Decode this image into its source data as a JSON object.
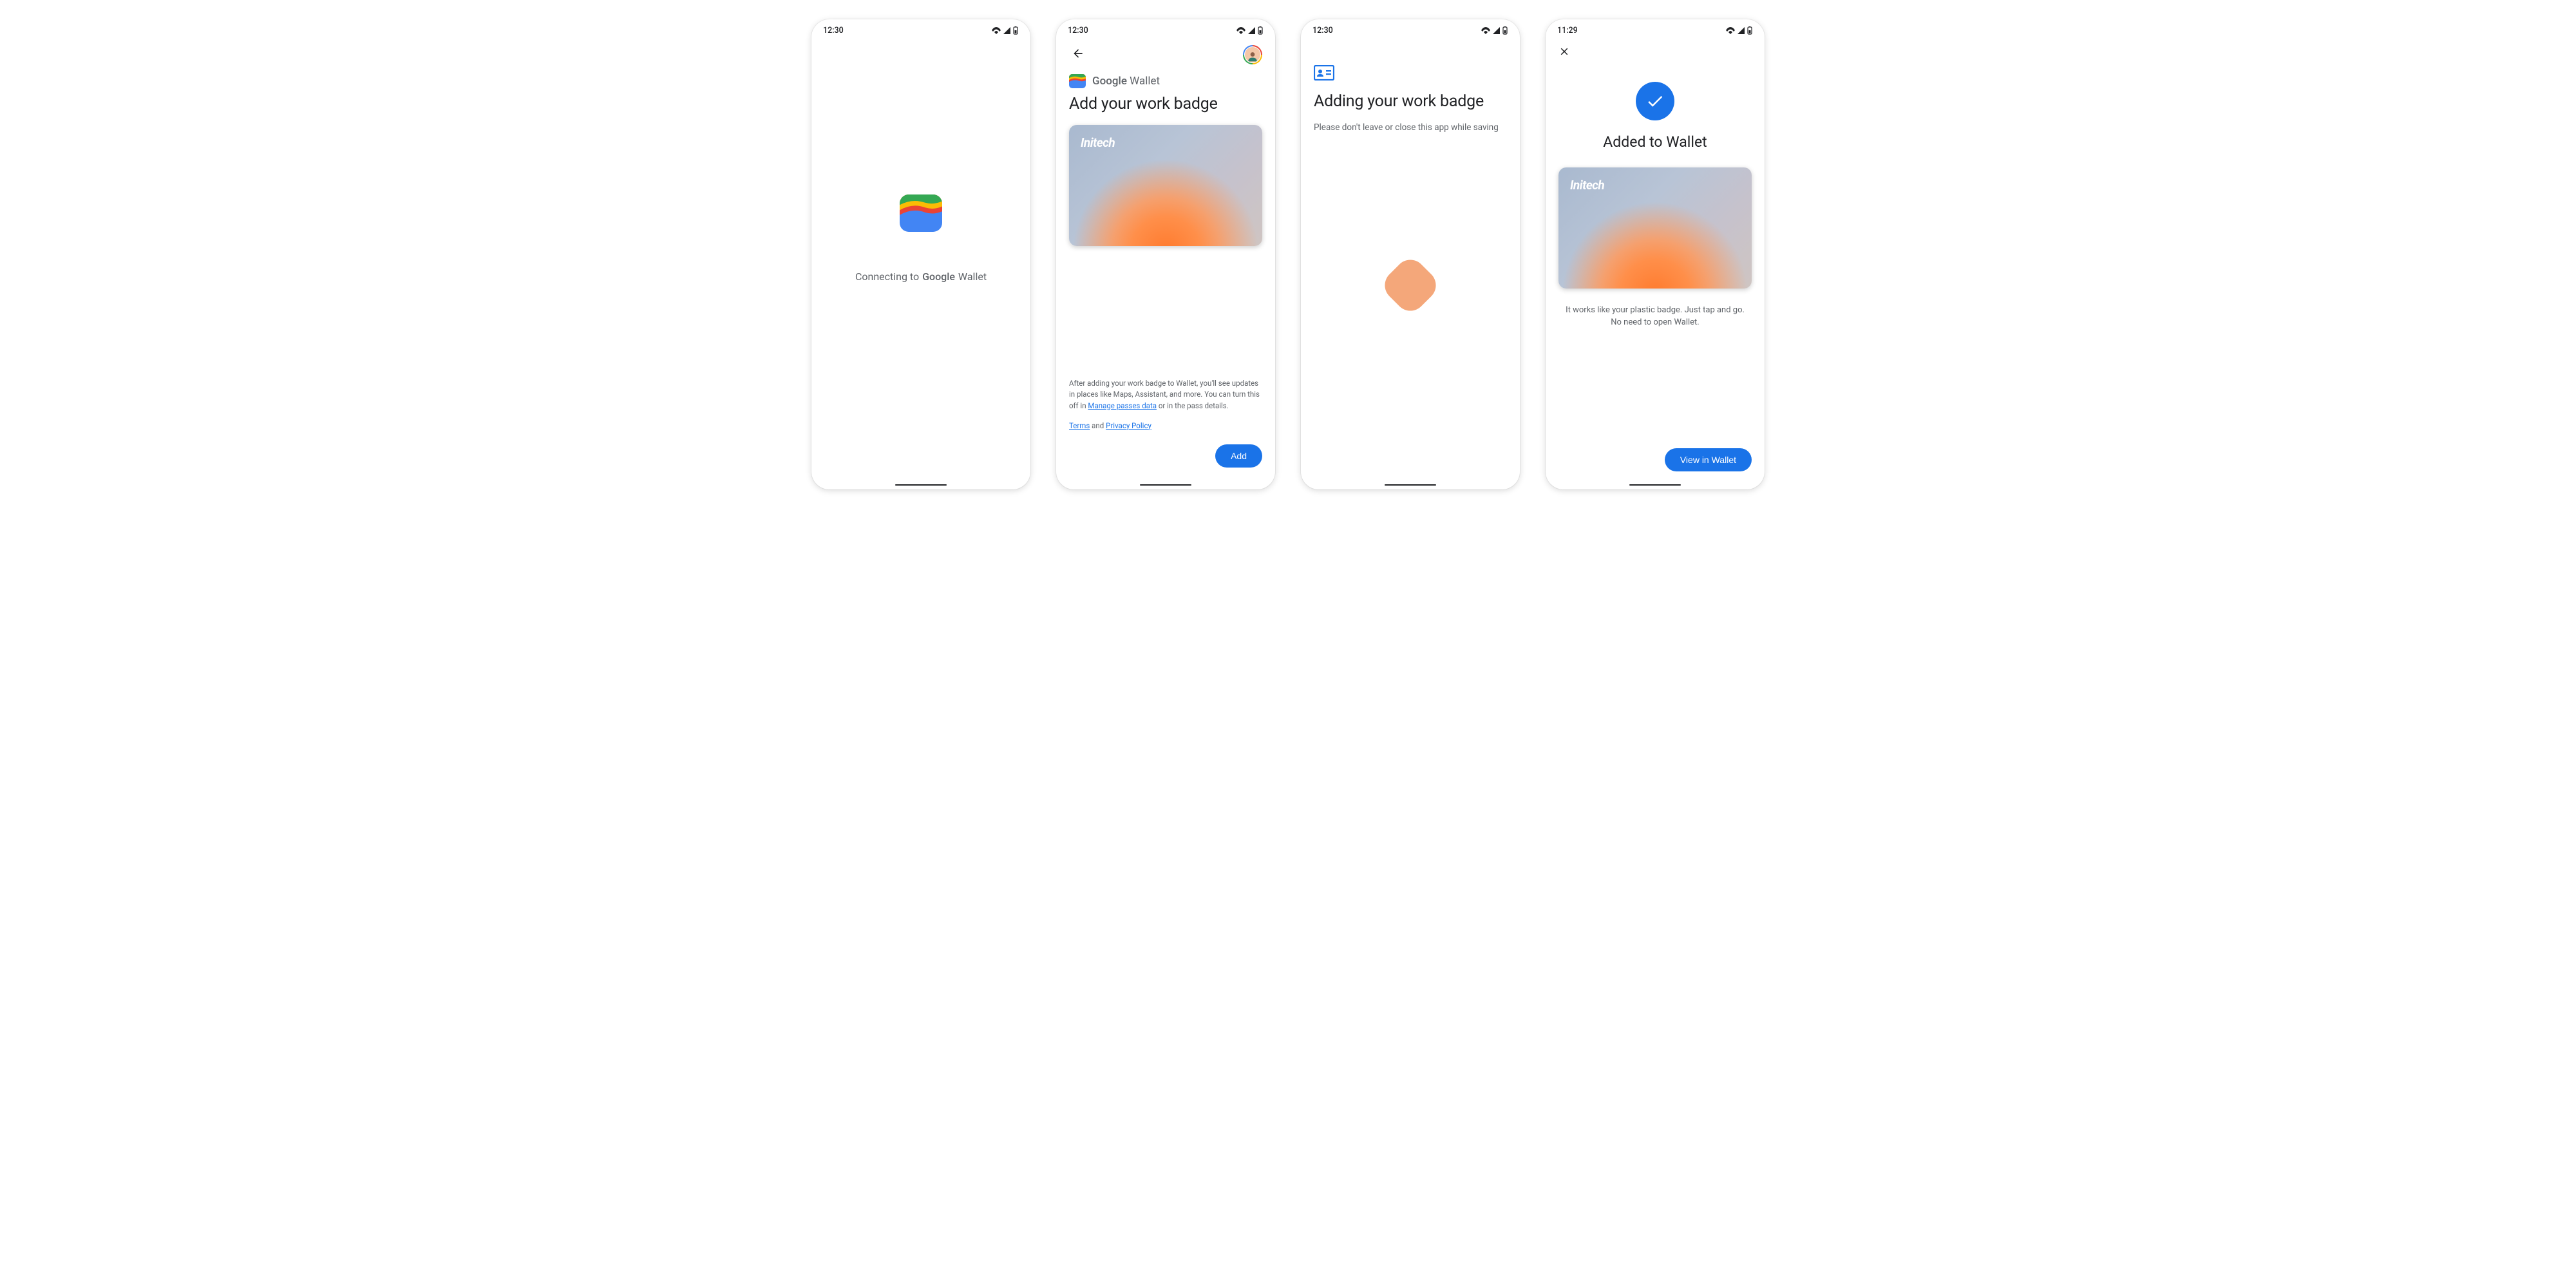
{
  "status": {
    "time_a": "12:30",
    "time_b": "11:29"
  },
  "screen1": {
    "connecting_prefix": "Connecting to",
    "brand_google": "Google",
    "brand_wallet": "Wallet"
  },
  "screen2": {
    "brand_google": "Google",
    "brand_wallet": "Wallet",
    "title": "Add your work badge",
    "card_brand": "Initech",
    "disclaimer_a": "After adding your work badge to Wallet, you'll see updates in places like Maps, Assistant, and more. You can turn this off in ",
    "manage_link": "Manage passes data",
    "disclaimer_b": " or in the pass details.",
    "terms": "Terms",
    "and": " and ",
    "privacy": "Privacy Policy",
    "add_button": "Add"
  },
  "screen3": {
    "title": "Adding your work badge",
    "subtitle": "Please don't leave or close this app while saving"
  },
  "screen4": {
    "title": "Added to Wallet",
    "card_brand": "Initech",
    "description": "It works like your plastic badge. Just tap and go. No need to open Wallet.",
    "view_button": "View in Wallet"
  }
}
